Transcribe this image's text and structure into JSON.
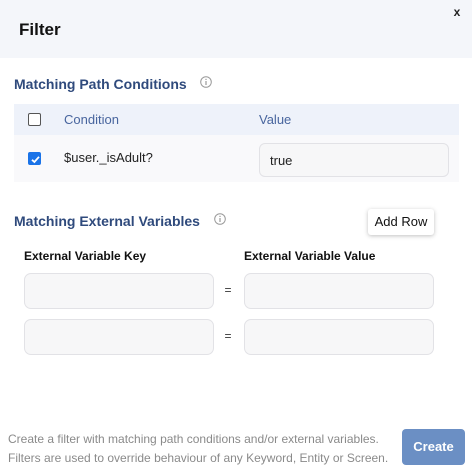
{
  "dialog": {
    "title": "Filter",
    "close_label": "x"
  },
  "path_conditions": {
    "title": "Matching Path Conditions",
    "columns": {
      "condition": "Condition",
      "value": "Value"
    },
    "header_checked": false,
    "rows": [
      {
        "checked": true,
        "condition": "$user._isAdult?",
        "value": "true"
      }
    ]
  },
  "external_variables": {
    "title": "Matching External Variables",
    "add_row_label": "Add Row",
    "key_label": "External Variable Key",
    "value_label": "External Variable Value",
    "equals": "=",
    "rows": [
      {
        "key": "",
        "value": ""
      },
      {
        "key": "",
        "value": ""
      }
    ]
  },
  "footer": {
    "description": "Create a filter with matching path conditions and/or external variables. Filters are used to override behaviour of any Keyword, Entity or Screen.",
    "create_label": "Create"
  },
  "colors": {
    "section_title": "#2f4a7c",
    "checkbox_checked": "#1a73e8",
    "create_button": "#6b8fc4"
  },
  "icons": {
    "info": "info-circle-icon",
    "check": "check-icon"
  }
}
